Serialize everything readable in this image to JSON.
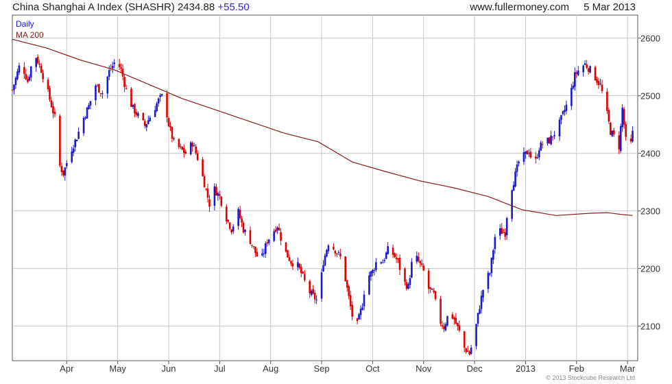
{
  "header": {
    "title": "China Shanghai A Index (SHASHR) 2434.88",
    "change": "+55.50",
    "site": "www.fullermoney.com",
    "date": "5 Mar 2013"
  },
  "footer": {
    "copyright": "© 2013 Stockcube Research Ltd"
  },
  "colors": {
    "up": "#1a1acc",
    "down": "#dd0000",
    "ma": "#8b1a1a",
    "grid": "#c8c8c8"
  },
  "chart_data": {
    "type": "candlestick",
    "title": "China Shanghai A Index (SHASHR)",
    "legend": [
      {
        "label": "Daily",
        "color": "#1a1acc"
      },
      {
        "label": "MA 200",
        "color": "#8b1a1a"
      }
    ],
    "legend_position": "top-left",
    "y_axis": {
      "position": "right",
      "ylim": [
        2040,
        2640
      ],
      "ticks": [
        2100,
        2200,
        2300,
        2400,
        2500,
        2600
      ],
      "grid": true
    },
    "x_axis": {
      "labels": [
        "Apr",
        "May",
        "Jun",
        "Jul",
        "Aug",
        "Sep",
        "Oct",
        "Nov",
        "Dec",
        "2013",
        "Feb",
        "Mar"
      ],
      "label_days": [
        32,
        62,
        92,
        122,
        152,
        182,
        212,
        242,
        272,
        302,
        332,
        362
      ],
      "xlim": [
        0,
        368
      ]
    },
    "price_path": [
      [
        0,
        2510
      ],
      [
        5,
        2560
      ],
      [
        9,
        2525
      ],
      [
        13,
        2575
      ],
      [
        17,
        2545
      ],
      [
        21,
        2505
      ],
      [
        25,
        2462
      ],
      [
        28,
        2378
      ],
      [
        30,
        2365
      ],
      [
        34,
        2402
      ],
      [
        38,
        2428
      ],
      [
        41,
        2455
      ],
      [
        45,
        2482
      ],
      [
        49,
        2518
      ],
      [
        53,
        2505
      ],
      [
        57,
        2542
      ],
      [
        61,
        2562
      ],
      [
        64,
        2545
      ],
      [
        68,
        2498
      ],
      [
        71,
        2478
      ],
      [
        74,
        2465
      ],
      [
        78,
        2448
      ],
      [
        82,
        2468
      ],
      [
        86,
        2492
      ],
      [
        89,
        2502
      ],
      [
        92,
        2450
      ],
      [
        95,
        2418
      ],
      [
        98,
        2410
      ],
      [
        102,
        2400
      ],
      [
        106,
        2418
      ],
      [
        109,
        2392
      ],
      [
        113,
        2348
      ],
      [
        116,
        2312
      ],
      [
        119,
        2338
      ],
      [
        122,
        2325
      ],
      [
        126,
        2288
      ],
      [
        129,
        2268
      ],
      [
        133,
        2298
      ],
      [
        136,
        2268
      ],
      [
        140,
        2248
      ],
      [
        143,
        2228
      ],
      [
        146,
        2210
      ],
      [
        150,
        2248
      ],
      [
        153,
        2262
      ],
      [
        156,
        2275
      ],
      [
        160,
        2232
      ],
      [
        164,
        2212
      ],
      [
        168,
        2205
      ],
      [
        171,
        2185
      ],
      [
        174,
        2162
      ],
      [
        177,
        2152
      ],
      [
        180,
        2142
      ],
      [
        183,
        2212
      ],
      [
        186,
        2245
      ],
      [
        190,
        2232
      ],
      [
        194,
        2215
      ],
      [
        197,
        2165
      ],
      [
        200,
        2118
      ],
      [
        203,
        2102
      ],
      [
        206,
        2138
      ],
      [
        208,
        2182
      ],
      [
        212,
        2195
      ],
      [
        215,
        2218
      ],
      [
        218,
        2212
      ],
      [
        221,
        2232
      ],
      [
        224,
        2225
      ],
      [
        227,
        2212
      ],
      [
        230,
        2178
      ],
      [
        233,
        2168
      ],
      [
        236,
        2228
      ],
      [
        239,
        2212
      ],
      [
        242,
        2195
      ],
      [
        245,
        2165
      ],
      [
        248,
        2155
      ],
      [
        251,
        2112
      ],
      [
        254,
        2098
      ],
      [
        257,
        2125
      ],
      [
        260,
        2112
      ],
      [
        263,
        2090
      ],
      [
        266,
        2062
      ],
      [
        269,
        2052
      ],
      [
        272,
        2085
      ],
      [
        275,
        2135
      ],
      [
        278,
        2178
      ],
      [
        281,
        2192
      ],
      [
        284,
        2255
      ],
      [
        287,
        2265
      ],
      [
        290,
        2262
      ],
      [
        292,
        2322
      ],
      [
        295,
        2352
      ],
      [
        298,
        2385
      ],
      [
        301,
        2395
      ],
      [
        304,
        2405
      ],
      [
        307,
        2375
      ],
      [
        310,
        2410
      ],
      [
        313,
        2420
      ],
      [
        316,
        2422
      ],
      [
        319,
        2435
      ],
      [
        322,
        2452
      ],
      [
        325,
        2475
      ],
      [
        328,
        2498
      ],
      [
        331,
        2535
      ],
      [
        334,
        2548
      ],
      [
        337,
        2555
      ],
      [
        340,
        2545
      ],
      [
        343,
        2532
      ],
      [
        346,
        2518
      ],
      [
        349,
        2482
      ],
      [
        352,
        2438
      ],
      [
        355,
        2425
      ],
      [
        357,
        2412
      ],
      [
        359,
        2478
      ],
      [
        361,
        2422
      ],
      [
        363,
        2398
      ],
      [
        365,
        2434.88
      ]
    ],
    "ma_200": [
      [
        0,
        2598
      ],
      [
        20,
        2583
      ],
      [
        40,
        2562
      ],
      [
        60,
        2545
      ],
      [
        80,
        2520
      ],
      [
        100,
        2495
      ],
      [
        120,
        2475
      ],
      [
        140,
        2455
      ],
      [
        160,
        2435
      ],
      [
        180,
        2420
      ],
      [
        200,
        2385
      ],
      [
        220,
        2368
      ],
      [
        240,
        2352
      ],
      [
        260,
        2340
      ],
      [
        280,
        2325
      ],
      [
        300,
        2302
      ],
      [
        320,
        2292
      ],
      [
        340,
        2296
      ],
      [
        350,
        2297
      ],
      [
        358,
        2294
      ],
      [
        365,
        2292
      ]
    ]
  }
}
